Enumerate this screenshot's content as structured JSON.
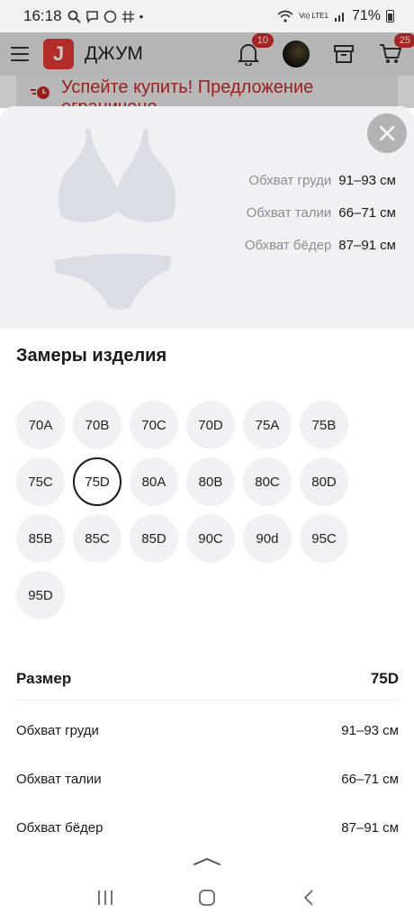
{
  "status_bar": {
    "time": "16:18",
    "left_icons": [
      "search-icon",
      "chat-icon",
      "whatsapp-icon",
      "grid-icon",
      "dot-icon"
    ],
    "network": "Vo) LTE1",
    "battery": "71%"
  },
  "header": {
    "logo_letter": "J",
    "brand": "ДЖУМ",
    "notifications_count": "10",
    "cart_count": "25"
  },
  "promo": {
    "text": "Успейте купить! Предложение ограничено"
  },
  "sheet": {
    "body_measures": [
      {
        "label": "Обхват груди",
        "value": "91–93 см"
      },
      {
        "label": "Обхват талии",
        "value": "66–71 см"
      },
      {
        "label": "Обхват бёдер",
        "value": "87–91 см"
      }
    ],
    "section_title": "Замеры изделия",
    "sizes": [
      "70A",
      "70B",
      "70C",
      "70D",
      "75A",
      "75B",
      "75C",
      "75D",
      "80A",
      "80B",
      "80C",
      "80D",
      "85B",
      "85C",
      "85D",
      "90C",
      "90d",
      "95C",
      "95D"
    ],
    "selected_size": "75D",
    "table": {
      "header_label": "Размер",
      "header_value": "75D",
      "rows": [
        {
          "label": "Обхват груди",
          "value": "91–93 см"
        },
        {
          "label": "Обхват талии",
          "value": "66–71 см"
        },
        {
          "label": "Обхват бёдер",
          "value": "87–91 см"
        }
      ]
    }
  },
  "colors": {
    "accent": "#e53935",
    "chip_bg": "#f1f1f4",
    "muted_text": "#8a8d96"
  }
}
